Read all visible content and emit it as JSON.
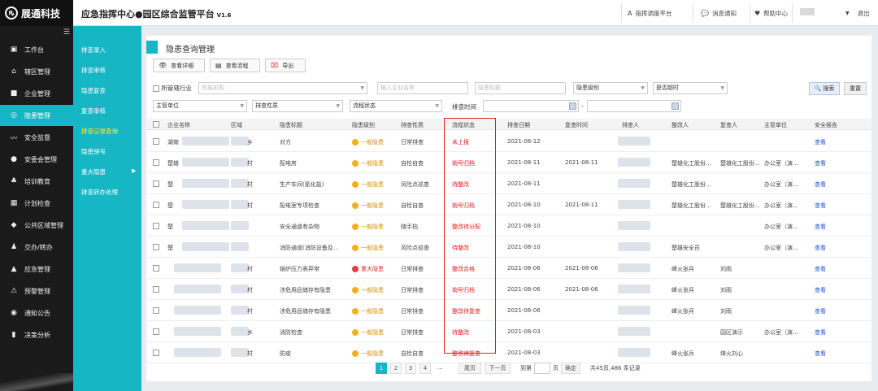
{
  "brand": {
    "name": "展通科技"
  },
  "header": {
    "title": "应急指挥中心●园区综合监管平台",
    "version": "V1.6",
    "links": [
      {
        "label": "指挥调度平台",
        "icon": "letter-a-icon"
      },
      {
        "label": "消息通知",
        "icon": "chat-bubble-icon"
      },
      {
        "label": "帮助中心",
        "icon": "heart-icon"
      },
      {
        "label": "退出",
        "icon": "chevron-down-icon"
      }
    ]
  },
  "sidebar": {
    "items": [
      {
        "label": "工作台",
        "icon": "dashboard-icon"
      },
      {
        "label": "辖区管理",
        "icon": "home-icon"
      },
      {
        "label": "企业管理",
        "icon": "briefcase-icon"
      },
      {
        "label": "隐患管理",
        "icon": "target-icon"
      },
      {
        "label": "安全监督",
        "icon": "pulse-icon"
      },
      {
        "label": "安委会管理",
        "icon": "user-icon"
      },
      {
        "label": "培训教育",
        "icon": "group-icon"
      },
      {
        "label": "计划检查",
        "icon": "calendar-icon"
      },
      {
        "label": "公共区域管理",
        "icon": "cube-icon"
      },
      {
        "label": "交办/转办",
        "icon": "people-icon"
      },
      {
        "label": "应急管理",
        "icon": "bell-icon"
      },
      {
        "label": "预警管理",
        "icon": "warning-icon"
      },
      {
        "label": "通知公告",
        "icon": "broadcast-icon"
      },
      {
        "label": "决策分析",
        "icon": "bar-chart-icon"
      }
    ],
    "active": 3
  },
  "submenu": {
    "items": [
      "排查录入",
      "排查审核",
      "隐患复查",
      "复查审核",
      "排查记录查询",
      "隐患销号",
      "重大隐患",
      "排查转办处理"
    ],
    "current": 4
  },
  "page": {
    "title": "隐患查询管理"
  },
  "toolbar": {
    "view_detail": "查看详细",
    "view_flow": "查看流程",
    "export": "导出"
  },
  "filters": {
    "all_industry": "所管辖行业",
    "org_placeholder": "所属机构",
    "company_placeholder": "输入企业名称",
    "hazard_title_placeholder": "隐患标题",
    "level": "隐患级别",
    "overdue": "是否超时",
    "dept": "主管单位",
    "nature": "排查性质",
    "flow": "流程状态",
    "time_label": "排查时间",
    "range_sep": "-",
    "search": "搜索",
    "reset": "重置"
  },
  "table": {
    "headers": [
      "企业名称",
      "区域",
      "隐患标题",
      "隐患级别",
      "排查性质",
      "流程状态",
      "排查日期",
      "复查时间",
      "排查人",
      "整改人",
      "复查人",
      "主管单位",
      "安全报告"
    ],
    "rows": [
      {
        "company": "湖南",
        "region": "乡",
        "title": "对方",
        "level": "一般隐患",
        "nature": "日常排查",
        "status": "未上报",
        "date": "2021-08-12",
        "review": "",
        "rectifier": "",
        "reviewer": "",
        "dept": "",
        "report": "查看"
      },
      {
        "company": "楚雄",
        "region": "村",
        "title": "配电房",
        "level": "一般隐患",
        "nature": "自检自查",
        "status": "销号归档",
        "date": "2021-08-11",
        "review": "2021-08-11",
        "rectifier": "楚雄化工股份...",
        "reviewer": "楚雄化工股份...",
        "dept": "办公室（演...",
        "report": "查看"
      },
      {
        "company": "楚",
        "region": "村",
        "title": "生产车间(氰化盐)",
        "level": "一般隐患",
        "nature": "风险点巡查",
        "status": "待整改",
        "date": "2021-08-11",
        "review": "",
        "rectifier": "楚雄化工股份...",
        "reviewer": "",
        "dept": "办公室（演...",
        "report": "查看"
      },
      {
        "company": "楚",
        "region": "村",
        "title": "配电室专项检查",
        "level": "一般隐患",
        "nature": "自检自查",
        "status": "销号归档",
        "date": "2021-08-10",
        "review": "2021-08-11",
        "rectifier": "楚雄化工股份...",
        "reviewer": "楚雄化工股份...",
        "dept": "办公室（演...",
        "report": "查看"
      },
      {
        "company": "楚",
        "region": "",
        "title": "安全通道有杂物",
        "level": "一般隐患",
        "nature": "随手拍",
        "status": "整改待分配",
        "date": "2021-08-10",
        "review": "",
        "rectifier": "",
        "reviewer": "",
        "dept": "办公室（演...",
        "report": "查看"
      },
      {
        "company": "楚",
        "region": "",
        "title": "消防通道(消防设备及...",
        "level": "一般隐患",
        "nature": "风险点巡查",
        "status": "待整改",
        "date": "2021-08-10",
        "review": "",
        "rectifier": "楚雄安全员",
        "reviewer": "",
        "dept": "办公室（演...",
        "report": "查看"
      },
      {
        "company": "",
        "region": "村",
        "title": "锅炉压力表异常",
        "level": "重大隐患",
        "nature": "日常排查",
        "status": "整改合格",
        "date": "2021-08-06",
        "review": "2021-08-06",
        "rectifier": "峰火张兵",
        "reviewer": "刘雨",
        "dept": "",
        "report": "查看"
      },
      {
        "company": "",
        "region": "村",
        "title": "涉危用品储存有隐患",
        "level": "一般隐患",
        "nature": "日常排查",
        "status": "销号归档",
        "date": "2021-08-06",
        "review": "2021-08-06",
        "rectifier": "峰火张兵",
        "reviewer": "刘雨",
        "dept": "",
        "report": "查看"
      },
      {
        "company": "",
        "region": "村",
        "title": "涉危用品储存有隐患",
        "level": "一般隐患",
        "nature": "日常排查",
        "status": "整改待复查",
        "date": "2021-08-06",
        "review": "",
        "rectifier": "峰火张兵",
        "reviewer": "刘雨",
        "dept": "",
        "report": "查看"
      },
      {
        "company": "",
        "region": "乡",
        "title": "消防检查",
        "level": "一般隐患",
        "nature": "日常排查",
        "status": "待整改",
        "date": "2021-08-03",
        "review": "",
        "rectifier": "",
        "reviewer": "园区演示",
        "dept": "办公室（演...",
        "report": "查看"
      },
      {
        "company": "",
        "region": "村",
        "title": "防疫",
        "level": "一般隐患",
        "nature": "自检自查",
        "status": "整改待复查",
        "date": "2021-08-03",
        "review": "",
        "rectifier": "峰火张兵",
        "reviewer": "烽火刘心",
        "dept": "",
        "report": "查看"
      }
    ]
  },
  "pagination": {
    "pages": [
      "1",
      "2",
      "3",
      "4"
    ],
    "ellipsis": "...",
    "prev": "尾页",
    "next": "下一页",
    "goto": "到第",
    "page_unit": "页",
    "confirm": "确定",
    "summary": "共45页,486 条记录",
    "current": 1
  }
}
